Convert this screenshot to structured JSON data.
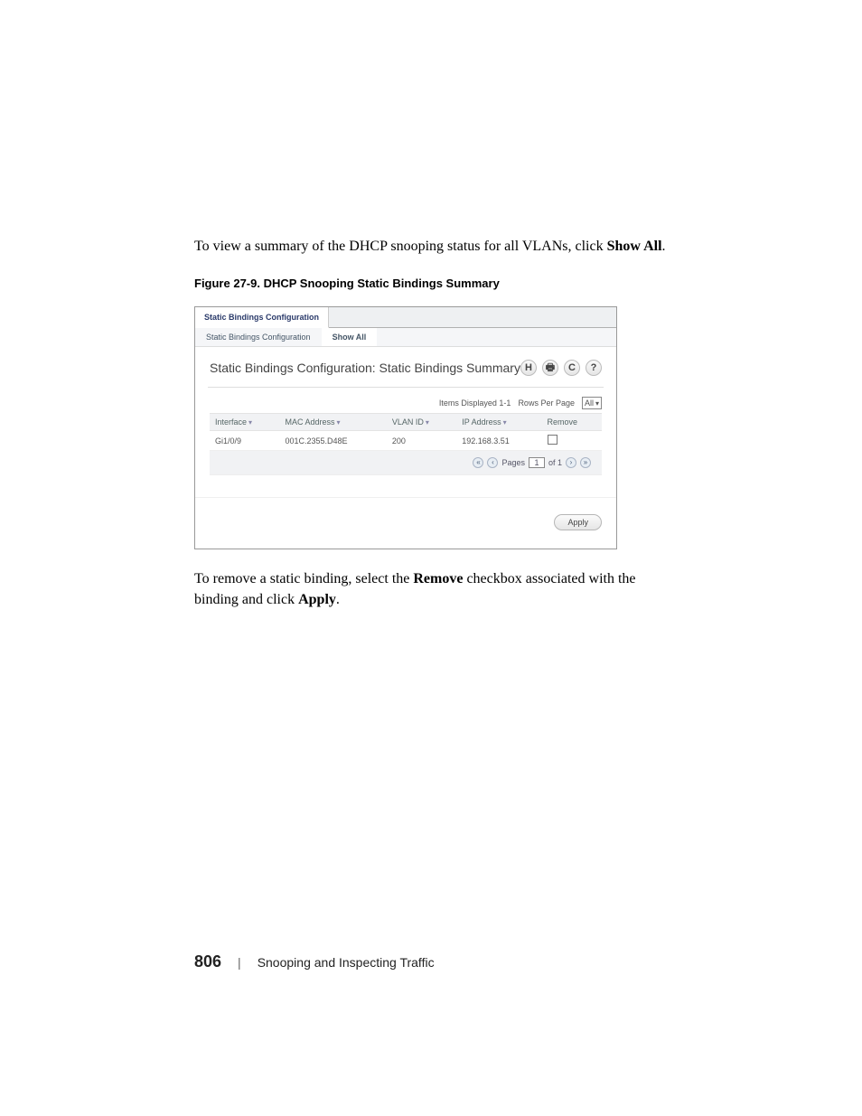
{
  "body_text_1_pre": "To view a summary of the DHCP snooping status for all VLANs, click ",
  "body_text_1_bold": "Show All",
  "body_text_1_post": ".",
  "figure_caption": "Figure 27-9.    DHCP Snooping Static Bindings Summary",
  "ui": {
    "tab_main": "Static Bindings Configuration",
    "subtab_config": "Static Bindings Configuration",
    "subtab_showall": "Show All",
    "panel_title": "Static Bindings Configuration: Static Bindings Summary",
    "icons": {
      "save": "H",
      "print": "🖶",
      "refresh": "C",
      "help": "?"
    },
    "items_displayed": "Items Displayed 1-1",
    "rows_per_page_label": "Rows Per Page",
    "rows_per_page_value": "All",
    "columns": {
      "interface": "Interface",
      "mac": "MAC Address",
      "vlan": "VLAN ID",
      "ip": "IP Address",
      "remove": "Remove"
    },
    "row": {
      "interface": "Gi1/0/9",
      "mac": "001C.2355.D48E",
      "vlan": "200",
      "ip": "192.168.3.51"
    },
    "pager": {
      "pages_label": "Pages",
      "page_value": "1",
      "of_label": "of 1"
    },
    "apply": "Apply"
  },
  "body_text_2_pre": "To remove a static binding, select the ",
  "body_text_2_bold1": "Remove",
  "body_text_2_mid": " checkbox associated with the binding and click ",
  "body_text_2_bold2": "Apply",
  "body_text_2_post": ".",
  "footer": {
    "page": "806",
    "sep": "|",
    "chapter": "Snooping and Inspecting Traffic"
  }
}
